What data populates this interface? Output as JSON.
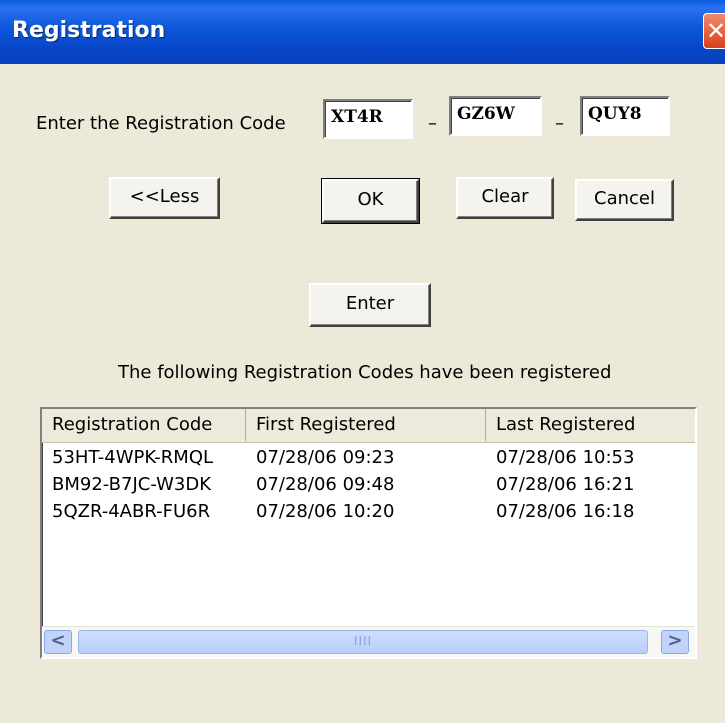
{
  "window": {
    "title": "Registration",
    "close_glyph": "✕"
  },
  "form": {
    "prompt": "Enter the Registration Code",
    "code1": "XT4R",
    "code2": "GZ6W",
    "code3": "QUY8",
    "separator": "–"
  },
  "buttons": {
    "less": "<<Less",
    "ok": "OK",
    "clear": "Clear",
    "cancel": "Cancel",
    "enter": "Enter"
  },
  "list": {
    "caption": "The following Registration Codes have been registered",
    "columns": [
      "Registration Code",
      "First Registered",
      "Last Registered"
    ],
    "rows": [
      [
        "53HT-4WPK-RMQL",
        "07/28/06  09:23",
        "07/28/06  10:53"
      ],
      [
        "BM92-B7JC-W3DK",
        "07/28/06  09:48",
        "07/28/06  16:21"
      ],
      [
        "5QZR-4ABR-FU6R",
        "07/28/06  10:20",
        "07/28/06  16:18"
      ]
    ],
    "scroll_left_glyph": "<",
    "scroll_right_glyph": ">",
    "thumb_grip": "IIII"
  },
  "icons": {
    "close": "close-icon",
    "scroll_left": "chevron-left-icon",
    "scroll_right": "chevron-right-icon"
  },
  "colors": {
    "titlebar": "#0b57d8",
    "dialog_bg": "#ece9d8",
    "close_button": "#d9411c"
  }
}
